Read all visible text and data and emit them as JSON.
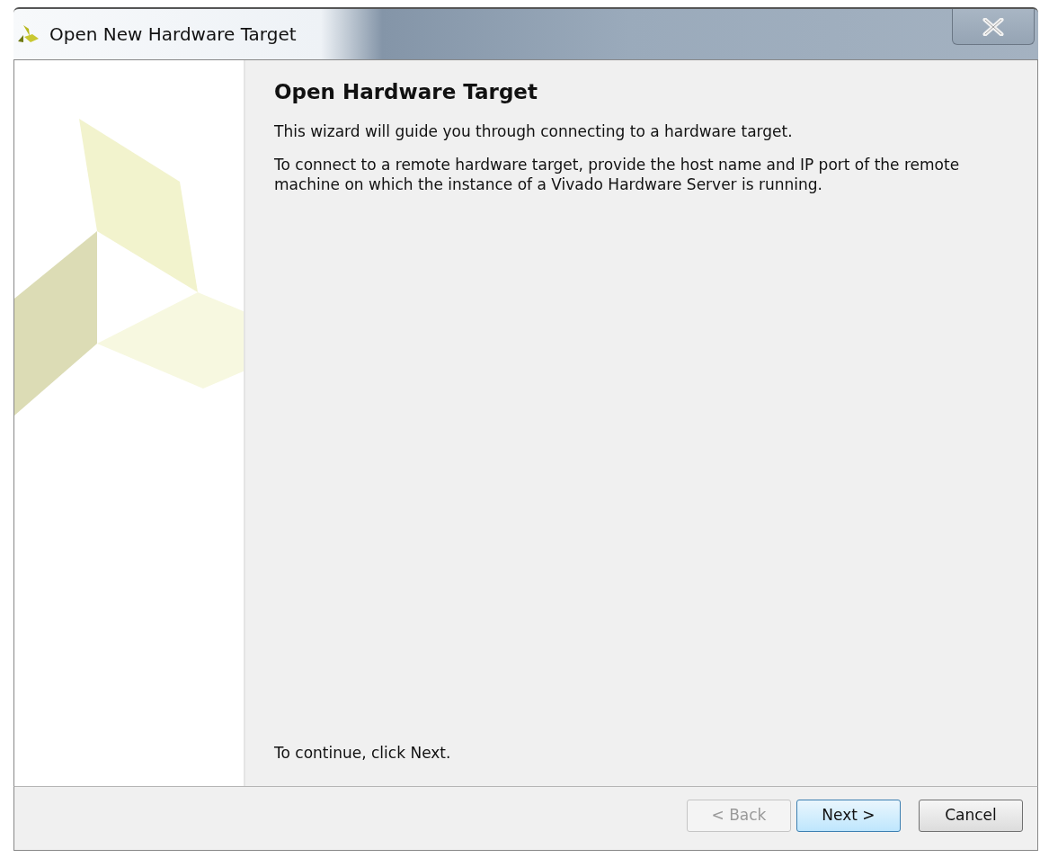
{
  "window": {
    "title": "Open New Hardware Target"
  },
  "page": {
    "heading": "Open Hardware Target",
    "paragraphs": [
      "This wizard will guide you through connecting to a hardware target.",
      "To connect to a remote hardware target, provide the host name and IP port of the remote machine on which the instance of a Vivado Hardware Server is running."
    ],
    "footer_note": "To continue, click Next."
  },
  "buttons": [
    {
      "label": "< Back",
      "disabled": true,
      "default": false
    },
    {
      "label": "Next >",
      "disabled": false,
      "default": true
    },
    {
      "label": "Cancel",
      "disabled": false,
      "default": false
    }
  ]
}
